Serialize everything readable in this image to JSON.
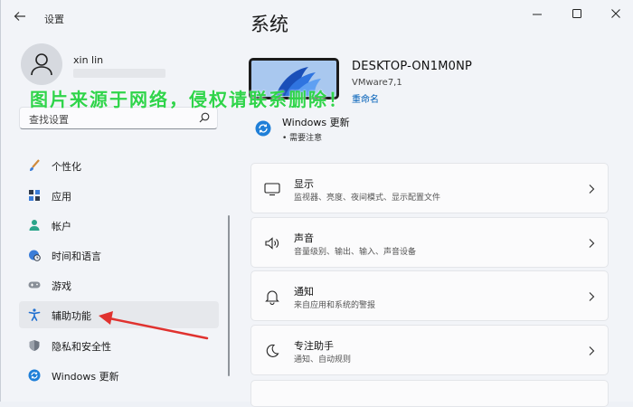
{
  "window": {
    "title": "设置"
  },
  "user": {
    "name": "xin lin"
  },
  "search": {
    "placeholder": "查找设置"
  },
  "sidebar": {
    "items": [
      {
        "label": "个性化",
        "icon": "paintbrush-icon"
      },
      {
        "label": "应用",
        "icon": "apps-icon"
      },
      {
        "label": "帐户",
        "icon": "person-icon"
      },
      {
        "label": "时间和语言",
        "icon": "globe-clock-icon"
      },
      {
        "label": "游戏",
        "icon": "gamepad-icon"
      },
      {
        "label": "辅助功能",
        "icon": "accessibility-icon",
        "selected": true
      },
      {
        "label": "隐私和安全性",
        "icon": "shield-icon"
      },
      {
        "label": "Windows 更新",
        "icon": "windows-update-icon"
      }
    ]
  },
  "main": {
    "heading": "系统",
    "device": {
      "name": "DESKTOP-ON1M0NP",
      "model": "VMware7,1",
      "rename_label": "重命名"
    },
    "update": {
      "title": "Windows 更新",
      "status": "• 需要注意"
    },
    "cards": [
      {
        "title": "显示",
        "subtitle": "监视器、亮度、夜间模式、显示配置文件",
        "icon": "monitor-icon"
      },
      {
        "title": "声音",
        "subtitle": "音量级别、输出、输入、声音设备",
        "icon": "speaker-icon"
      },
      {
        "title": "通知",
        "subtitle": "来自应用和系统的警报",
        "icon": "bell-icon"
      },
      {
        "title": "专注助手",
        "subtitle": "通知、自动规则",
        "icon": "moon-icon"
      }
    ]
  },
  "overlay": {
    "watermark": "图片来源于网络，侵权请联系删除！"
  },
  "colors": {
    "accent": "#005fb8",
    "selection": "#e6e8ec",
    "watermark": "#2fd44a",
    "arrow": "#e0322f"
  }
}
